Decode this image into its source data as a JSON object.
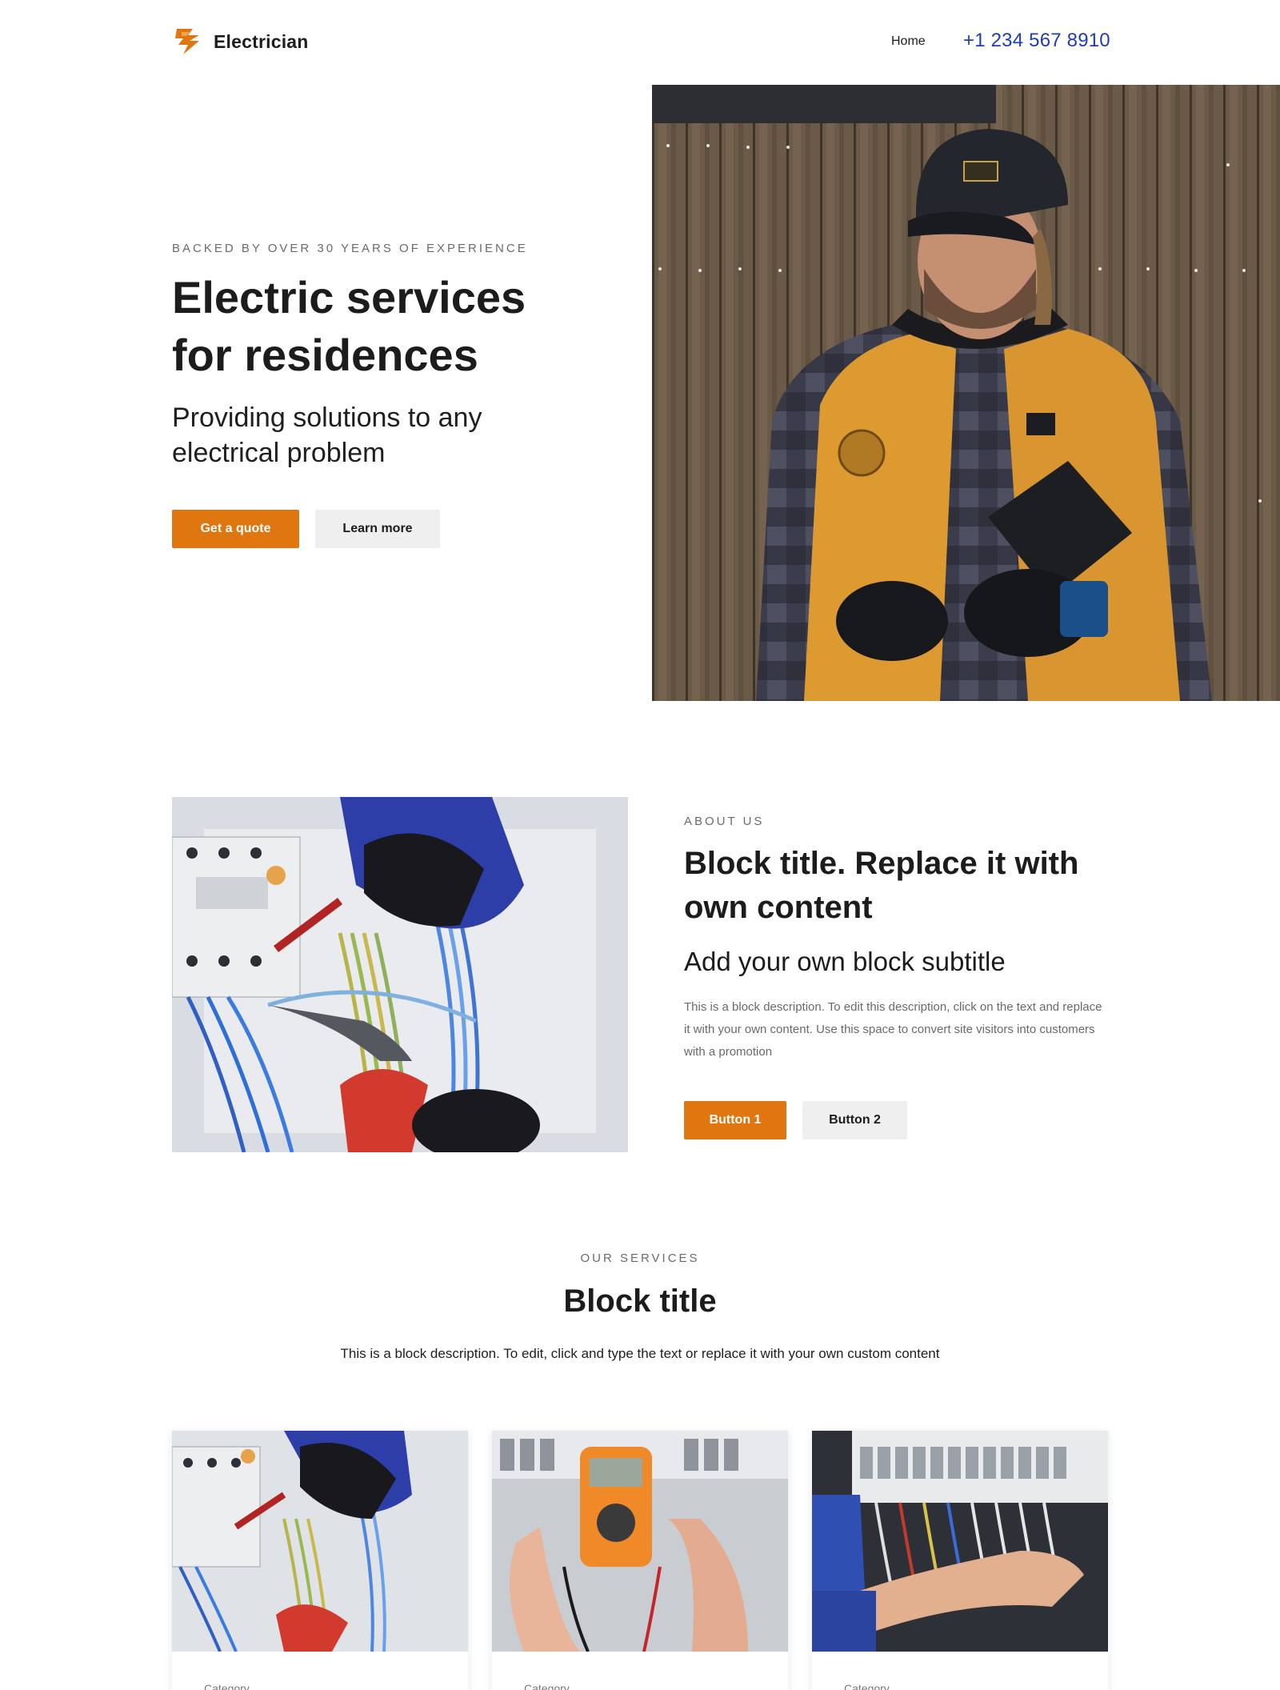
{
  "header": {
    "brand": "Electrician",
    "nav_home": "Home",
    "phone": "+1 234 567 8910"
  },
  "hero": {
    "eyebrow": "BACKED BY OVER 30 YEARS OF EXPERIENCE",
    "title": "Electric services for residences",
    "subtitle": "Providing solutions to any electrical problem",
    "primary_button": "Get a quote",
    "secondary_button": "Learn more"
  },
  "about": {
    "eyebrow": "ABOUT US",
    "title": "Block title. Replace it with own content",
    "subtitle": "Add your own block subtitle",
    "description": "This is a block description. To edit this description, click on the text and replace it with your own content. Use this space to convert site visitors into customers with a promotion",
    "button1": "Button 1",
    "button2": "Button 2"
  },
  "services": {
    "eyebrow": "OUR SERVICES",
    "title": "Block title",
    "description": "This is a block description. To edit, click and type the text or replace it with your own custom content",
    "cards": [
      {
        "category": "Category"
      },
      {
        "category": "Category"
      },
      {
        "category": "Category"
      }
    ]
  },
  "colors": {
    "accent": "#e0760f",
    "phone_link": "#1f3fb0",
    "secondary_button": "#efefef",
    "text": "#1c1c1c"
  },
  "icons": {
    "logo": "lightning-bolt-icon"
  }
}
